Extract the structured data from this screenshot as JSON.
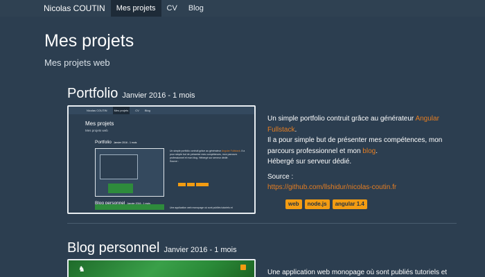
{
  "navbar": {
    "brand": "Nicolas COUTIN",
    "links": [
      "Mes projets",
      "CV",
      "Blog"
    ],
    "active_index": 0
  },
  "header": {
    "title": "Mes projets",
    "subtitle": "Mes projets web"
  },
  "projects": [
    {
      "name": "Portfolio",
      "date": "Janvier 2016 - 1 mois",
      "description": {
        "line1_prefix": "Un simple portfolio contruit grâce au générateur ",
        "line1_link": "Angular Fullstack",
        "line1_suffix": ".",
        "line2_prefix": "Il a pour simple but de présenter mes compétences, mon parcours professionnel et mon ",
        "line2_link": "blog",
        "line2_suffix": ".",
        "line3": "Hébergé sur serveur dédié."
      },
      "source_label": "Source :",
      "source_url": "https://github.com/llshidur/nicolas-coutin.fr",
      "tags": [
        "web",
        "node.js",
        "angular 1.4"
      ],
      "thumbnail": {
        "nav_brand": "Nicolas COUTIN",
        "nav_links": [
          "Mes projets",
          "CV",
          "Blog"
        ],
        "title": "Mes projets",
        "subtitle": "Mes projets web",
        "project_name": "Portfolio",
        "project_date": "Janvier 2016 - 1 mois",
        "text_prefix": "Un simple portfolio contruit grâce au générateur ",
        "text_link": "Angular Fullstack",
        "text_rest": ". Il a pour simple but de présenter mes compétences, mon parcours professionnel et mon blog. Hébergé sur serveur dédié.",
        "source": "Source :",
        "next_name": "Blog personnel",
        "next_date": "Janvier 2016 - 1 mois",
        "next_text": "Une application web monopage où sont publiés tutoriels et"
      }
    },
    {
      "name": "Blog personnel",
      "date": "Janvier 2016 - 1 mois",
      "description_start": "Une application web monopage où sont publiés tutoriels et"
    }
  ]
}
